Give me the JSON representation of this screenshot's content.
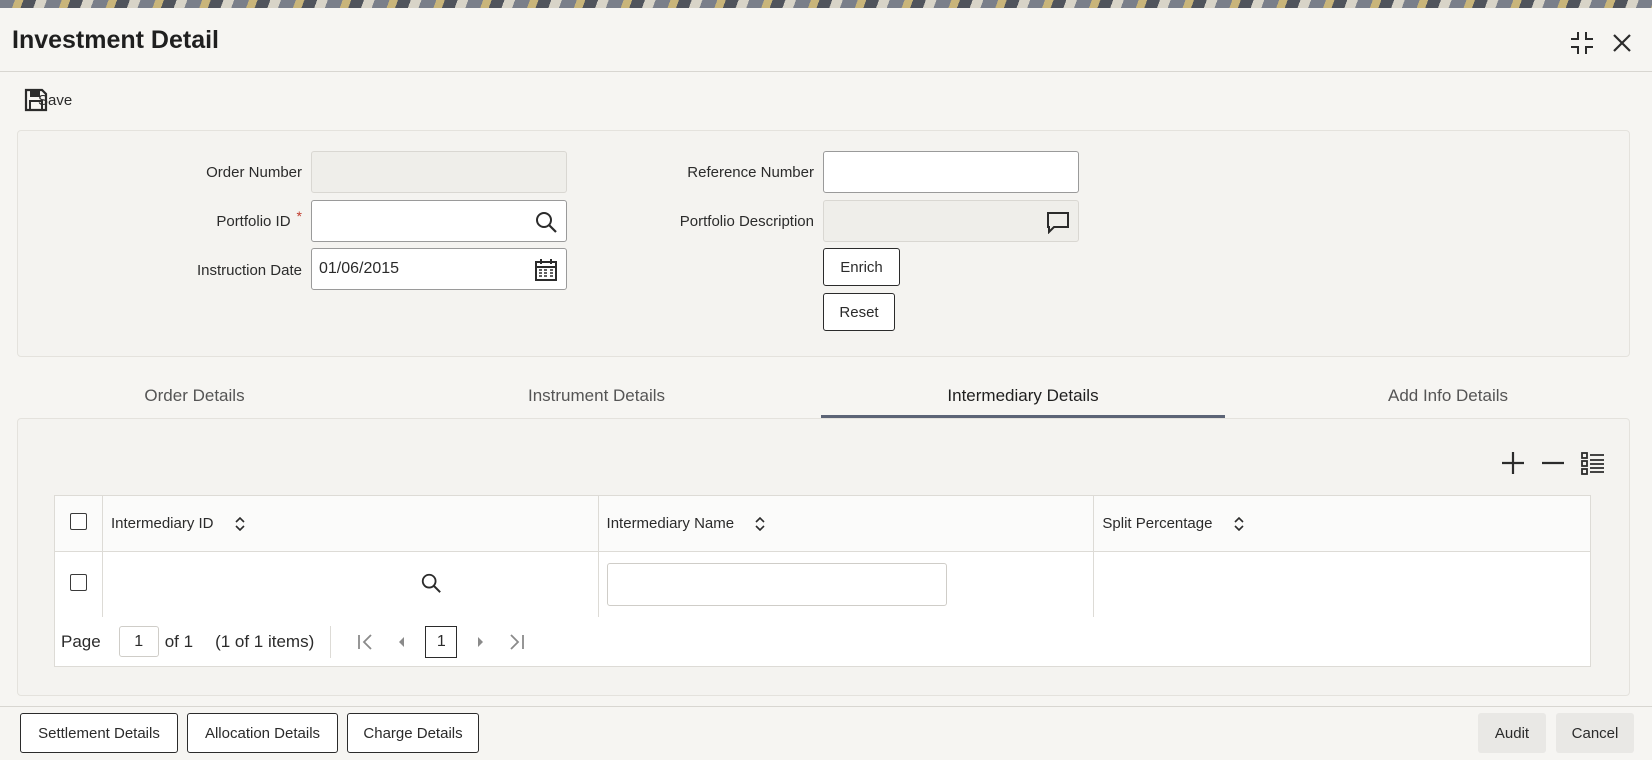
{
  "window": {
    "title": "Investment Detail",
    "maximize_icon": "maximize-icon",
    "close_icon": "close-icon"
  },
  "toolbar": {
    "save_label": "Save",
    "save_icon": "floppy-disk-icon"
  },
  "form": {
    "order_number": {
      "label": "Order Number",
      "value": ""
    },
    "portfolio_id": {
      "label": "Portfolio ID",
      "required_mark": "*",
      "value": ""
    },
    "instruction_date": {
      "label": "Instruction Date",
      "value": "01/06/2015"
    },
    "reference_number": {
      "label": "Reference Number",
      "value": ""
    },
    "portfolio_description": {
      "label": "Portfolio Description",
      "value": ""
    },
    "enrich_label": "Enrich",
    "reset_label": "Reset"
  },
  "tabs": [
    {
      "label": "Order Details",
      "active": false
    },
    {
      "label": "Instrument Details",
      "active": false
    },
    {
      "label": "Intermediary Details",
      "active": true
    },
    {
      "label": "Add Info Details",
      "active": false
    }
  ],
  "grid": {
    "columns": [
      "Intermediary ID",
      "Intermediary Name",
      "Split Percentage"
    ],
    "rows": [
      {
        "intermediary_id": "",
        "intermediary_name": "",
        "split_percentage": ""
      }
    ],
    "pager": {
      "page_label": "Page",
      "page_value": "1",
      "of_label": "of 1",
      "items_label": "(1 of 1 items)",
      "current_page": "1"
    }
  },
  "footer": {
    "settlement_details": "Settlement Details",
    "allocation_details": "Allocation Details",
    "charge_details": "Charge Details",
    "audit": "Audit",
    "cancel": "Cancel"
  },
  "colors": {
    "tab_active_underline": "#5c6476",
    "required": "#c0392b",
    "background": "#f6f5f2"
  }
}
